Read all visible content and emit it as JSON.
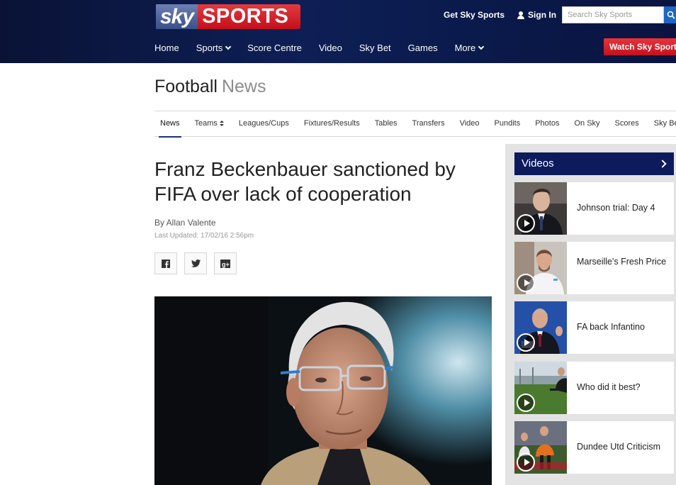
{
  "header": {
    "logo_sky": "sky",
    "logo_sports": "SPORTS",
    "get_sky_sports": "Get Sky Sports",
    "sign_in": "Sign In",
    "search_placeholder": "Search Sky Sports",
    "nav": [
      "Home",
      "Sports",
      "Score Centre",
      "Video",
      "Sky Bet",
      "Games",
      "More"
    ],
    "watch_button": "Watch Sky Sports"
  },
  "section": {
    "title": "Football",
    "subtitle": "News",
    "subnav": [
      "News",
      "Teams",
      "Leagues/Cups",
      "Fixtures/Results",
      "Tables",
      "Transfers",
      "Video",
      "Pundits",
      "Photos",
      "On Sky",
      "Scores",
      "Sky Bet"
    ]
  },
  "article": {
    "headline": "Franz Beckenbauer sanctioned by FIFA over lack of cooperation",
    "author": "By Allan Valente",
    "updated": "Last Updated: 17/02/16 2:56pm",
    "share": [
      "f",
      "t",
      "g+"
    ]
  },
  "sidebar": {
    "title": "Videos",
    "videos": [
      {
        "title": "Johnson trial: Day 4"
      },
      {
        "title": "Marseille's Fresh Price"
      },
      {
        "title": "FA back Infantino"
      },
      {
        "title": "Who did it best?"
      },
      {
        "title": "Dundee Utd Criticism"
      }
    ]
  },
  "colors": {
    "header_bg": "#0e1f56",
    "accent_red": "#c4121d",
    "videos_header": "#0d1b5c",
    "search_button": "#1c67c4"
  }
}
